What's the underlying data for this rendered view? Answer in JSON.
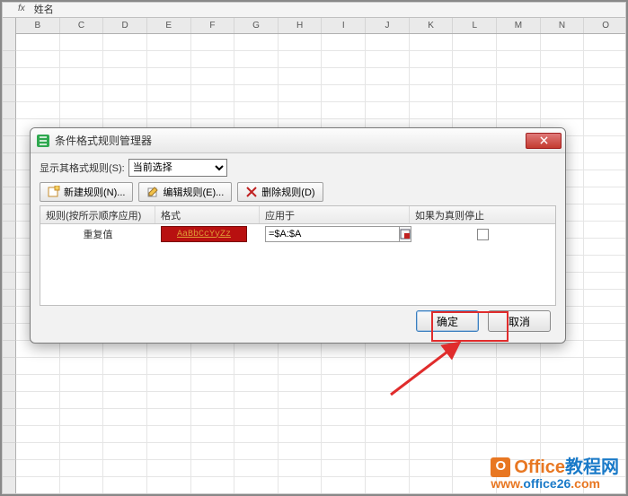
{
  "formula_bar": {
    "fx": "fx",
    "value": "姓名"
  },
  "columns": [
    "B",
    "C",
    "D",
    "E",
    "F",
    "G",
    "H",
    "I",
    "J",
    "K",
    "L",
    "M",
    "N",
    "O"
  ],
  "dialog": {
    "title": "条件格式规则管理器",
    "show_rules_label": "显示其格式规则(S):",
    "show_rules_value": "当前选择",
    "toolbar": {
      "new_rule": "新建规则(N)...",
      "edit_rule": "编辑规则(E)...",
      "delete_rule": "删除规则(D)"
    },
    "headers": {
      "rule": "规则(按所示顺序应用)",
      "format": "格式",
      "applies": "应用于",
      "stop": "如果为真则停止"
    },
    "rule_row": {
      "name": "重复值",
      "preview": "AaBbCcYyZz",
      "applies_to": "=$A:$A"
    },
    "buttons": {
      "ok": "确定",
      "cancel": "取消"
    }
  },
  "watermark": {
    "brand_office": "Office",
    "brand_suffix": "教程网",
    "url": "www.office26.com"
  }
}
